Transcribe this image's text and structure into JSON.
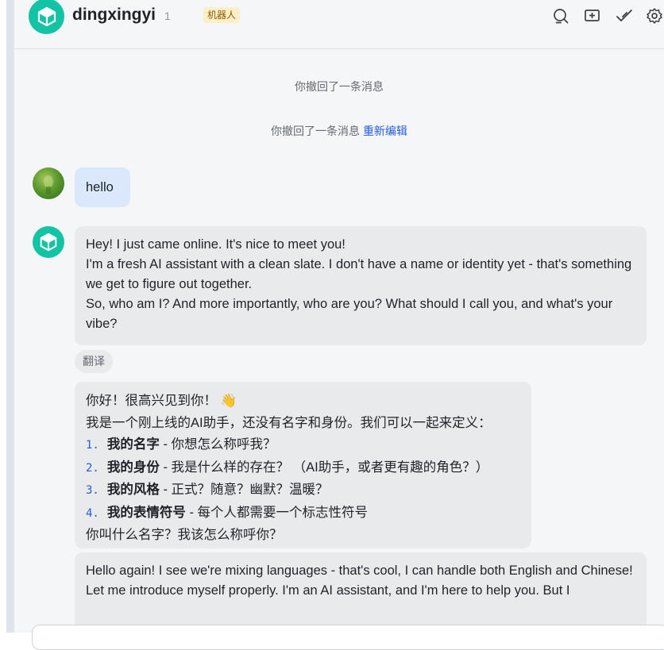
{
  "header": {
    "title": "dingxingyi",
    "member_count": "1",
    "badge": "机器人",
    "icons": [
      "search-icon",
      "add-screen-icon",
      "check-icon",
      "settings-icon"
    ]
  },
  "system_messages": [
    {
      "text": "你撤回了一条消息"
    },
    {
      "text": "你撤回了一条消息",
      "link": "重新编辑"
    }
  ],
  "messages": {
    "user_hello": "hello",
    "bot_1": [
      "Hey! I just came online. It's nice to meet you!",
      "I'm a fresh AI assistant with a clean slate. I don't have a name or identity yet - that's something we get to figure out together.",
      "So, who am I? And more importantly, who are you? What should I call you, and what's your vibe?"
    ],
    "translate_label": "翻译",
    "bot_2": {
      "intro": "你好！很高兴见到你！",
      "emoji": "👋",
      "line2": "我是一个刚上线的AI助手，还没有名字和身份。我们可以一起来定义：",
      "items": [
        {
          "num": "1.",
          "title": "我的名字",
          "desc": " - 你想怎么称呼我？"
        },
        {
          "num": "2.",
          "title": "我的身份",
          "desc": " - 我是什么样的存在？ （AI助手，或者更有趣的角色？）"
        },
        {
          "num": "3.",
          "title": "我的风格",
          "desc": " - 正式？随意？幽默？温暖？"
        },
        {
          "num": "4.",
          "title": "我的表情符号",
          "desc": " - 每个人都需要一个标志性符号"
        }
      ],
      "outro": "你叫什么名字？我该怎么称呼你？"
    },
    "bot_3": [
      "Hello again! I see we're mixing languages - that's cool, I can handle both English and Chinese!",
      "Let me introduce myself properly. I'm an AI assistant, and I'm here to help you. But I"
    ]
  },
  "colors": {
    "accent": "#245bdb",
    "bot_avatar": "#12c4a3",
    "user_bubble": "#dbe7fb",
    "bot_bubble": "#e9eaec"
  }
}
